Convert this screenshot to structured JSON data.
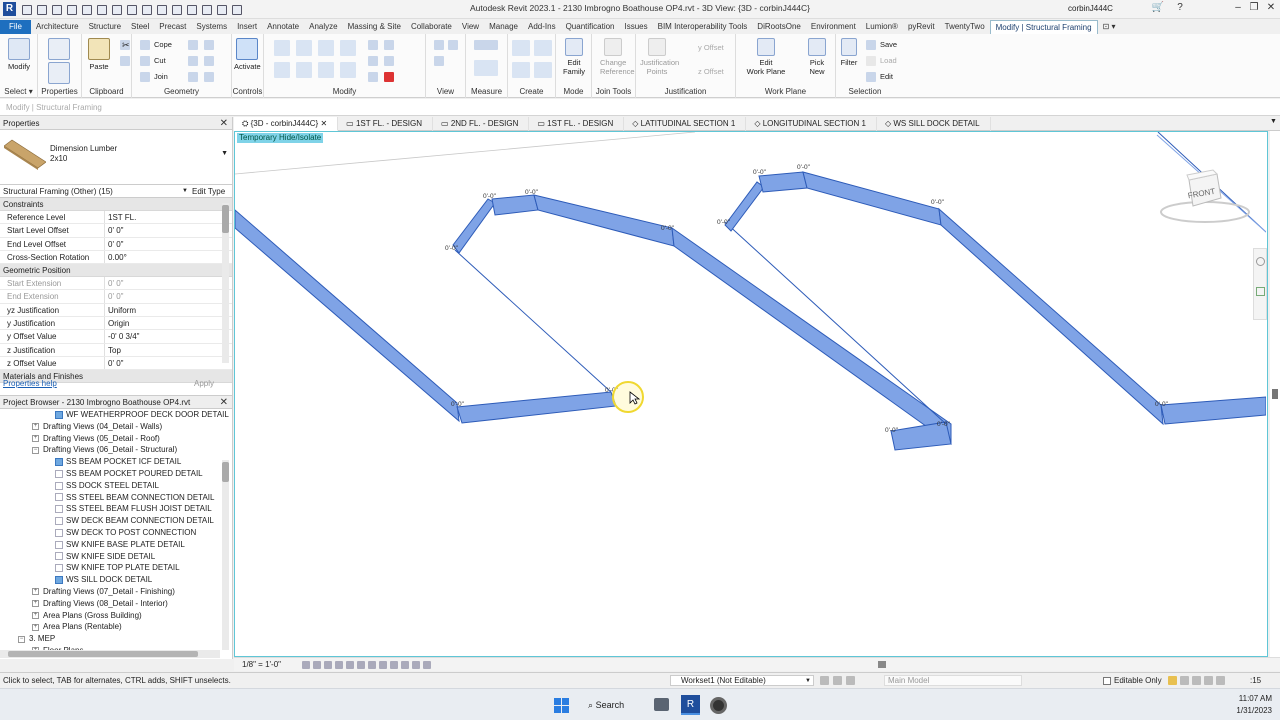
{
  "app": {
    "title": "Autodesk Revit 2023.1 - 2130 Imbrogno Boathouse OP4.rvt - 3D View: {3D - corbinJ444C}",
    "user": "corbinJ444C",
    "logo": "R"
  },
  "menu": {
    "tabs": [
      "File",
      "Architecture",
      "Structure",
      "Steel",
      "Precast",
      "Systems",
      "Insert",
      "Annotate",
      "Analyze",
      "Massing & Site",
      "Collaborate",
      "View",
      "Manage",
      "Add-Ins",
      "Quantification",
      "Issues",
      "BIM Interoperability Tools",
      "DiRootsOne",
      "Environment",
      "Lumion®",
      "pyRevit",
      "TwentyTwo",
      "Modify | Structural Framing"
    ]
  },
  "ribbon": {
    "panels": {
      "select": "Select",
      "properties": "Properties",
      "clipboard": "Clipboard",
      "geometry": "Geometry",
      "controls": "Controls",
      "modify": "Modify",
      "view": "View",
      "measure": "Measure",
      "create": "Create",
      "mode": "Mode",
      "join_tools": "Join Tools",
      "justification": "Justification",
      "work_plane": "Work Plane",
      "selection": "Selection"
    },
    "buttons": {
      "modify": "Modify",
      "paste": "Paste",
      "cope": "Cope",
      "cut": "Cut",
      "join": "Join",
      "activate": "Activate",
      "edit_family_1": "Edit",
      "edit_family_2": "Family",
      "change_ref_1": "Change",
      "change_ref_2": "Reference",
      "just_points_1": "Justification",
      "just_points_2": "Points",
      "y_offset": "y Offset",
      "z_offset": "z Offset",
      "edit_wp_1": "Edit",
      "edit_wp_2": "Work Plane",
      "pick_new_1": "Pick",
      "pick_new_2": "New",
      "filter": "Filter",
      "save": "Save",
      "load": "Load",
      "edit": "Edit"
    },
    "select_label": "Select ▾"
  },
  "optionsbar": {
    "text": "Modify | Structural Framing"
  },
  "properties": {
    "header": "Properties",
    "type_name": "Dimension Lumber",
    "type_size": "2x10",
    "filter": "Structural Framing (Other) (15)",
    "edit_type": "Edit Type",
    "sections": [
      {
        "name": "Constraints",
        "rows": [
          {
            "k": "Reference Level",
            "v": "1ST FL."
          },
          {
            "k": "Start Level Offset",
            "v": "0'  0\""
          },
          {
            "k": "End Level Offset",
            "v": "0'  0\""
          },
          {
            "k": "Cross-Section Rotation",
            "v": "0.00°"
          }
        ]
      },
      {
        "name": "Geometric Position",
        "rows": [
          {
            "k": "Start Extension",
            "v": "0'  0\"",
            "dis": true
          },
          {
            "k": "End Extension",
            "v": "0'  0\"",
            "dis": true
          },
          {
            "k": "yz Justification",
            "v": "Uniform"
          },
          {
            "k": "y Justification",
            "v": "Origin"
          },
          {
            "k": "y Offset Value",
            "v": "-0'  0 3/4\""
          },
          {
            "k": "z Justification",
            "v": "Top"
          },
          {
            "k": "z Offset Value",
            "v": "0'  0\""
          }
        ]
      },
      {
        "name": "Materials and Finishes",
        "rows": []
      }
    ],
    "help": "Properties help",
    "apply": "Apply"
  },
  "browser": {
    "header": "Project Browser - 2130 Imbrogno Boathouse OP4.rvt",
    "items": [
      {
        "t": "WF WEATHERPROOF DECK DOOR DETAIL",
        "lvl": 3,
        "icon": "blue"
      },
      {
        "t": "Drafting Views (04_Detail - Walls)",
        "lvl": 2,
        "tg": "+"
      },
      {
        "t": "Drafting Views (05_Detail - Roof)",
        "lvl": 2,
        "tg": "+"
      },
      {
        "t": "Drafting Views (06_Detail - Structural)",
        "lvl": 2,
        "tg": "−"
      },
      {
        "t": "SS BEAM POCKET ICF DETAIL",
        "lvl": 3,
        "icon": "blue"
      },
      {
        "t": "SS BEAM POCKET POURED DETAIL",
        "lvl": 3,
        "icon": "plain"
      },
      {
        "t": "SS DOCK STEEL DETAIL",
        "lvl": 3,
        "icon": "plain"
      },
      {
        "t": "SS STEEL BEAM CONNECTION DETAIL",
        "lvl": 3,
        "icon": "plain"
      },
      {
        "t": "SS STEEL BEAM FLUSH JOIST DETAIL",
        "lvl": 3,
        "icon": "plain"
      },
      {
        "t": "SW DECK BEAM CONNECTION DETAIL",
        "lvl": 3,
        "icon": "plain"
      },
      {
        "t": "SW DECK TO POST CONNECTION",
        "lvl": 3,
        "icon": "plain"
      },
      {
        "t": "SW KNIFE BASE PLATE DETAIL",
        "lvl": 3,
        "icon": "plain"
      },
      {
        "t": "SW KNIFE SIDE DETAIL",
        "lvl": 3,
        "icon": "plain"
      },
      {
        "t": "SW KNIFE TOP PLATE DETAIL",
        "lvl": 3,
        "icon": "plain"
      },
      {
        "t": "WS SILL DOCK DETAIL",
        "lvl": 3,
        "icon": "blue"
      },
      {
        "t": "Drafting Views (07_Detail - Finishing)",
        "lvl": 2,
        "tg": "+"
      },
      {
        "t": "Drafting Views (08_Detail - Interior)",
        "lvl": 2,
        "tg": "+"
      },
      {
        "t": "Area Plans (Gross Building)",
        "lvl": 2,
        "tg": "+"
      },
      {
        "t": "Area Plans (Rentable)",
        "lvl": 2,
        "tg": "+"
      },
      {
        "t": "3. MEP",
        "lvl": 1,
        "tg": "−"
      },
      {
        "t": "Floor Plans",
        "lvl": 2,
        "tg": "+"
      }
    ]
  },
  "viewtabs": [
    {
      "label": "{3D - corbinJ444C}",
      "active": true
    },
    {
      "label": "1ST FL. - DESIGN"
    },
    {
      "label": "2ND FL. - DESIGN"
    },
    {
      "label": "1ST FL. - DESIGN"
    },
    {
      "label": "LATITUDINAL SECTION 1"
    },
    {
      "label": "LONGITUDINAL SECTION 1"
    },
    {
      "label": "WS SILL DOCK DETAIL"
    }
  ],
  "canvas": {
    "temp_hide": "Temporary Hide/Isolate",
    "viewcube": "FRONT",
    "dim_label": "0'-0\""
  },
  "viewctrl": {
    "scale": "1/8\" = 1'-0\""
  },
  "status": {
    "hint": "Click to select, TAB for alternates, CTRL adds, SHIFT unselects.",
    "workset": "Workset1 (Not Editable)",
    "model": "Main Model",
    "editable_only": "Editable Only",
    "count": ":15"
  },
  "taskbar": {
    "search": "Search",
    "time": "11:07 AM",
    "date": "1/31/2023"
  },
  "colors": {
    "beam_fill": "#7fa3e6",
    "beam_edge": "#2d5bb8",
    "accent": "#1e6fbf"
  }
}
